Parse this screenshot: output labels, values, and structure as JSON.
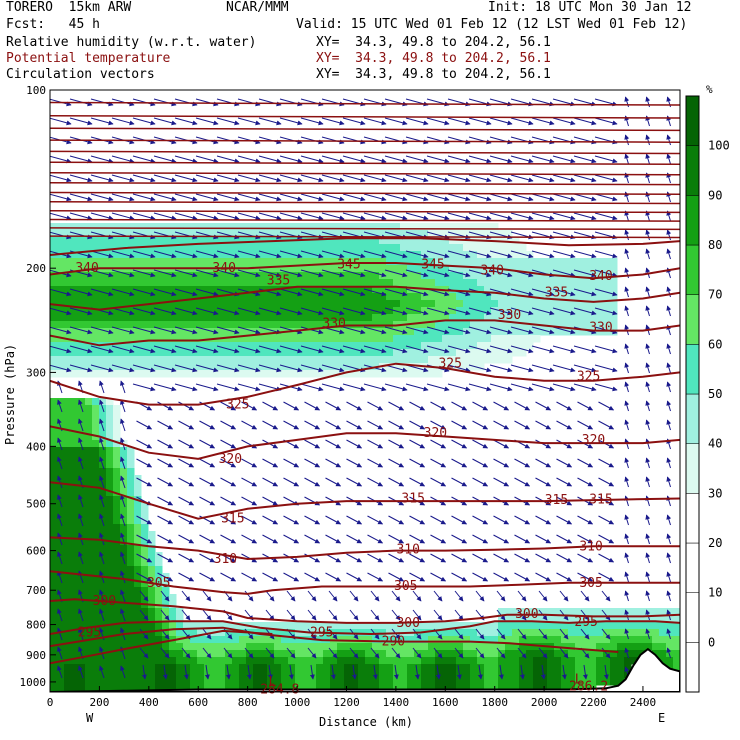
{
  "header": {
    "line1_left": "TORERO  15km ARW",
    "line1_mid": "NCAR/MMM",
    "line1_right": "Init: 18 UTC Mon 30 Jan 12",
    "line2_left": "Fcst:   45 h",
    "line2_right": "Valid: 15 UTC Wed 01 Feb 12 (12 LST Wed 01 Feb 12)",
    "fields": [
      {
        "name": "Relative humidity (w.r.t. water)",
        "xy": "XY=  34.3, 49.8 to 204.2, 56.1",
        "color": "#000000"
      },
      {
        "name": "Potential temperature",
        "xy": "XY=  34.3, 49.8 to 204.2, 56.1",
        "color": "#8b1010"
      },
      {
        "name": "Circulation vectors",
        "xy": "XY=  34.3, 49.8 to 204.2, 56.1",
        "color": "#000000"
      }
    ]
  },
  "chart_data": {
    "type": "cross-section",
    "xlabel": "Distance (km)",
    "ylabel": "Pressure (hPa)",
    "x_range": [
      0,
      2550
    ],
    "y_range": [
      100,
      1040
    ],
    "y_scale": "log",
    "x_ticks": [
      0,
      200,
      400,
      600,
      800,
      1000,
      1200,
      1400,
      1600,
      1800,
      2000,
      2200,
      2400
    ],
    "y_ticks": [
      100,
      200,
      300,
      400,
      500,
      600,
      700,
      800,
      900,
      1000
    ],
    "x_endpoints": {
      "left": "W",
      "right": "E"
    },
    "colorbar": {
      "unit": "%",
      "levels": [
        0,
        10,
        20,
        30,
        40,
        50,
        60,
        70,
        80,
        90,
        100
      ],
      "colors": [
        "#ffffff",
        "#ffffff",
        "#ffffff",
        "#ffffff",
        "#dcfaf0",
        "#a0f0e0",
        "#50e6be",
        "#64e664",
        "#32c832",
        "#14a014",
        "#0a7d0a",
        "#056405"
      ]
    },
    "theta_contours": [
      {
        "value": 285,
        "points": [
          [
            0,
            930
          ],
          [
            150,
            905
          ],
          [
            300,
            880
          ],
          [
            500,
            850
          ],
          [
            700,
            820
          ],
          [
            900,
            830
          ]
        ]
      },
      {
        "value": 290,
        "points": [
          [
            0,
            870
          ],
          [
            150,
            850
          ],
          [
            300,
            830
          ],
          [
            500,
            815
          ],
          [
            700,
            810
          ],
          [
            850,
            830
          ],
          [
            1100,
            850
          ],
          [
            1400,
            855
          ],
          [
            1700,
            855
          ],
          [
            1850,
            860
          ],
          [
            2000,
            870
          ],
          [
            2150,
            880
          ],
          [
            2300,
            890
          ]
        ]
      },
      {
        "value": 295,
        "points": [
          [
            0,
            830
          ],
          [
            150,
            810
          ],
          [
            300,
            795
          ],
          [
            500,
            790
          ],
          [
            700,
            790
          ],
          [
            850,
            810
          ],
          [
            1050,
            825
          ],
          [
            1300,
            830
          ],
          [
            1500,
            825
          ],
          [
            1700,
            805
          ],
          [
            1800,
            790
          ],
          [
            1950,
            790
          ],
          [
            2100,
            795
          ],
          [
            2250,
            790
          ],
          [
            2450,
            790
          ],
          [
            2550,
            795
          ]
        ]
      },
      {
        "value": 300,
        "points": [
          [
            0,
            730
          ],
          [
            100,
            725
          ],
          [
            300,
            735
          ],
          [
            500,
            745
          ],
          [
            700,
            760
          ],
          [
            800,
            780
          ],
          [
            1000,
            790
          ],
          [
            1200,
            795
          ],
          [
            1400,
            795
          ],
          [
            1600,
            790
          ],
          [
            1750,
            780
          ],
          [
            1850,
            770
          ],
          [
            2000,
            770
          ],
          [
            2200,
            775
          ],
          [
            2400,
            775
          ],
          [
            2550,
            770
          ]
        ]
      },
      {
        "value": 305,
        "points": [
          [
            0,
            650
          ],
          [
            150,
            660
          ],
          [
            300,
            670
          ],
          [
            500,
            690
          ],
          [
            700,
            705
          ],
          [
            800,
            710
          ],
          [
            900,
            700
          ],
          [
            1100,
            690
          ],
          [
            1300,
            690
          ],
          [
            1500,
            690
          ],
          [
            1700,
            690
          ],
          [
            1900,
            685
          ],
          [
            2100,
            680
          ],
          [
            2300,
            680
          ],
          [
            2550,
            680
          ]
        ]
      },
      {
        "value": 310,
        "points": [
          [
            0,
            570
          ],
          [
            200,
            575
          ],
          [
            400,
            590
          ],
          [
            600,
            600
          ],
          [
            800,
            620
          ],
          [
            1000,
            615
          ],
          [
            1200,
            605
          ],
          [
            1400,
            600
          ],
          [
            1600,
            600
          ],
          [
            1800,
            598
          ],
          [
            2000,
            595
          ],
          [
            2200,
            590
          ],
          [
            2550,
            590
          ]
        ]
      },
      {
        "value": 315,
        "points": [
          [
            0,
            460
          ],
          [
            200,
            470
          ],
          [
            400,
            500
          ],
          [
            600,
            530
          ],
          [
            800,
            510
          ],
          [
            1000,
            500
          ],
          [
            1200,
            495
          ],
          [
            1400,
            495
          ],
          [
            1600,
            495
          ],
          [
            1800,
            495
          ],
          [
            2000,
            495
          ],
          [
            2300,
            492
          ],
          [
            2550,
            490
          ]
        ]
      },
      {
        "value": 320,
        "points": [
          [
            0,
            370
          ],
          [
            200,
            385
          ],
          [
            400,
            410
          ],
          [
            600,
            420
          ],
          [
            800,
            400
          ],
          [
            1000,
            390
          ],
          [
            1200,
            380
          ],
          [
            1400,
            380
          ],
          [
            1600,
            385
          ],
          [
            1800,
            390
          ],
          [
            2000,
            395
          ],
          [
            2200,
            395
          ],
          [
            2400,
            395
          ],
          [
            2550,
            390
          ]
        ]
      },
      {
        "value": 325,
        "points": [
          [
            0,
            310
          ],
          [
            200,
            330
          ],
          [
            400,
            340
          ],
          [
            600,
            340
          ],
          [
            800,
            330
          ],
          [
            1000,
            315
          ],
          [
            1200,
            300
          ],
          [
            1400,
            290
          ],
          [
            1600,
            295
          ],
          [
            1800,
            305
          ],
          [
            2000,
            310
          ],
          [
            2200,
            310
          ],
          [
            2400,
            305
          ],
          [
            2550,
            300
          ]
        ]
      },
      {
        "value": 330,
        "points": [
          [
            0,
            260
          ],
          [
            200,
            270
          ],
          [
            400,
            265
          ],
          [
            600,
            265
          ],
          [
            800,
            260
          ],
          [
            1000,
            255
          ],
          [
            1200,
            250
          ],
          [
            1400,
            250
          ],
          [
            1600,
            245
          ],
          [
            1800,
            245
          ],
          [
            2000,
            250
          ],
          [
            2200,
            255
          ],
          [
            2400,
            255
          ],
          [
            2550,
            250
          ]
        ]
      },
      {
        "value": 335,
        "points": [
          [
            0,
            230
          ],
          [
            200,
            235
          ],
          [
            400,
            230
          ],
          [
            600,
            225
          ],
          [
            800,
            220
          ],
          [
            1000,
            215
          ],
          [
            1200,
            215
          ],
          [
            1400,
            215
          ],
          [
            1600,
            218
          ],
          [
            1800,
            220
          ],
          [
            2000,
            225
          ],
          [
            2200,
            228
          ],
          [
            2400,
            225
          ],
          [
            2550,
            220
          ]
        ]
      },
      {
        "value": 340,
        "points": [
          [
            0,
            205
          ],
          [
            200,
            200
          ],
          [
            400,
            200
          ],
          [
            600,
            200
          ],
          [
            800,
            200
          ],
          [
            1000,
            198
          ],
          [
            1200,
            196
          ],
          [
            1400,
            196
          ],
          [
            1600,
            198
          ],
          [
            1800,
            200
          ],
          [
            2000,
            205
          ],
          [
            2200,
            208
          ],
          [
            2400,
            205
          ],
          [
            2550,
            200
          ]
        ]
      },
      {
        "value": 345,
        "points": [
          [
            0,
            190
          ],
          [
            300,
            185
          ],
          [
            600,
            182
          ],
          [
            900,
            180
          ],
          [
            1200,
            178
          ],
          [
            1500,
            178
          ],
          [
            1800,
            180
          ],
          [
            2100,
            183
          ],
          [
            2400,
            182
          ],
          [
            2550,
            180
          ]
        ]
      }
    ],
    "labels": [
      {
        "text": "340",
        "x": 150,
        "p": 200
      },
      {
        "text": "340",
        "x": 705,
        "p": 200
      },
      {
        "text": "335",
        "x": 925,
        "p": 210
      },
      {
        "text": "345",
        "x": 1210,
        "p": 197
      },
      {
        "text": "345",
        "x": 1550,
        "p": 197
      },
      {
        "text": "340",
        "x": 1790,
        "p": 202
      },
      {
        "text": "335",
        "x": 2050,
        "p": 220
      },
      {
        "text": "340",
        "x": 2230,
        "p": 206
      },
      {
        "text": "330",
        "x": 1150,
        "p": 248
      },
      {
        "text": "330",
        "x": 1860,
        "p": 240
      },
      {
        "text": "330",
        "x": 2230,
        "p": 252
      },
      {
        "text": "325",
        "x": 1620,
        "p": 290
      },
      {
        "text": "325",
        "x": 2180,
        "p": 305
      },
      {
        "text": "325",
        "x": 760,
        "p": 340
      },
      {
        "text": "320",
        "x": 1560,
        "p": 380
      },
      {
        "text": "320",
        "x": 2200,
        "p": 390
      },
      {
        "text": "320",
        "x": 730,
        "p": 420
      },
      {
        "text": "315",
        "x": 1470,
        "p": 490
      },
      {
        "text": "315",
        "x": 2050,
        "p": 493
      },
      {
        "text": "315",
        "x": 2230,
        "p": 492
      },
      {
        "text": "315",
        "x": 740,
        "p": 530
      },
      {
        "text": "310",
        "x": 1450,
        "p": 598
      },
      {
        "text": "310",
        "x": 2190,
        "p": 590
      },
      {
        "text": "310",
        "x": 710,
        "p": 620
      },
      {
        "text": "305",
        "x": 440,
        "p": 680
      },
      {
        "text": "305",
        "x": 1440,
        "p": 688
      },
      {
        "text": "305",
        "x": 2190,
        "p": 680
      },
      {
        "text": "300",
        "x": 220,
        "p": 730
      },
      {
        "text": "300",
        "x": 1930,
        "p": 768
      },
      {
        "text": "300",
        "x": 1450,
        "p": 795
      },
      {
        "text": "295",
        "x": 2170,
        "p": 792
      },
      {
        "text": "295",
        "x": 160,
        "p": 825
      },
      {
        "text": "295",
        "x": 1100,
        "p": 825
      },
      {
        "text": "290",
        "x": 1390,
        "p": 855
      }
    ],
    "surface_lows": [
      {
        "text": "L",
        "x": 900,
        "p": 1000
      },
      {
        "text": "284.8",
        "x": 930,
        "p": 1030
      },
      {
        "text": "L",
        "x": 2140,
        "p": 990
      },
      {
        "text": "286.2",
        "x": 2180,
        "p": 1018
      }
    ]
  }
}
